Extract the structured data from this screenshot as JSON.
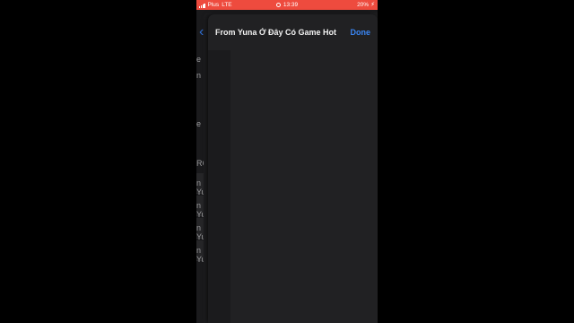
{
  "status_bar": {
    "carrier": "Plus",
    "network": "LTE",
    "time": "13:39",
    "battery": "20%",
    "color": "#ee4b3e"
  },
  "background_page": {
    "back_icon": "chevron-left-icon",
    "fragments": [
      "e",
      "n",
      "e",
      "RCH",
      "n Yu",
      "n Yu",
      "n Yu",
      "n Yu"
    ]
  },
  "sheet": {
    "title": "From Yuna Ở Đây Có Game Hot",
    "done_label": "Done",
    "accent": "#3a86f4"
  }
}
